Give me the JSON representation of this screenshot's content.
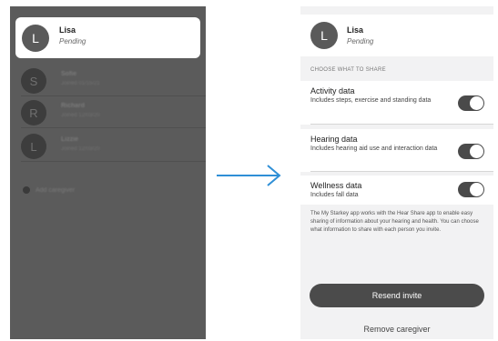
{
  "left": {
    "selected": {
      "initial": "L",
      "name": "Lisa",
      "status": "Pending"
    },
    "rows": [
      {
        "initial": "S",
        "name": "Sofie",
        "joined": "Joined 01/15/21"
      },
      {
        "initial": "R",
        "name": "Richard",
        "joined": "Joined 12/03/20"
      },
      {
        "initial": "L",
        "name": "Lizzie",
        "joined": "Joined 12/03/20"
      }
    ],
    "add_label": "Add caregiver"
  },
  "right": {
    "header": {
      "initial": "L",
      "name": "Lisa",
      "status": "Pending"
    },
    "section_title": "CHOOSE WHAT TO SHARE",
    "options": [
      {
        "title": "Activity data",
        "desc": "Includes steps, exercise and standing data",
        "enabled": true
      },
      {
        "title": "Hearing data",
        "desc": "Includes hearing aid use and interaction data",
        "enabled": true
      },
      {
        "title": "Wellness data",
        "desc": "Includes fall data",
        "enabled": true
      }
    ],
    "note": "The My Starkey app works with the Hear Share app to enable easy sharing of information about your hearing and health. You can choose what information to share with each person you invite.",
    "resend_label": "Resend invite",
    "remove_label": "Remove caregiver"
  },
  "colors": {
    "arrow": "#2f8fd6",
    "toggle_on": "#4a4a4a",
    "overlay": "#5b5b5b"
  }
}
